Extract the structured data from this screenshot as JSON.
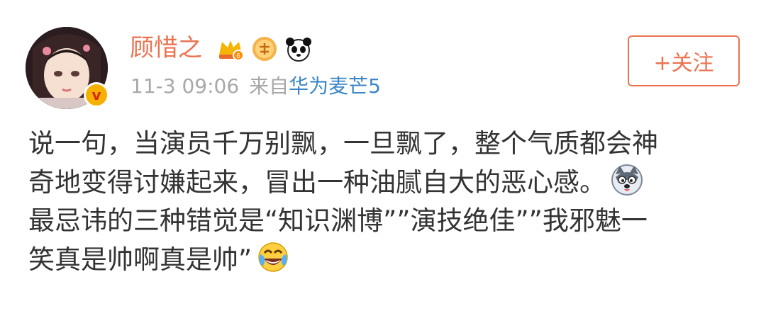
{
  "post": {
    "author": {
      "name": "顾惜之",
      "verified_mark": "v",
      "badges": [
        "crown-level-6-badge",
        "answer-badge",
        "panda-badge"
      ]
    },
    "timestamp": "11-3 09:06",
    "source_label": "来自",
    "source_device": "华为麦芒5",
    "follow_label": "+关注",
    "text_lines": [
      "说一句，当演员千万别飘，一旦飘了，整个气质都会神",
      "奇地变得讨嫌起来，冒出一种油腻自大的恶心感。",
      "最忌讳的三种错觉是“知识渊博””演技绝佳””我邪魅一",
      "笑真是帅啊真是帅”"
    ],
    "emojis": [
      "husky-emoji",
      "laughing-tears-emoji"
    ]
  },
  "colors": {
    "username": "#eb7350",
    "link": "#3b86c6",
    "meta": "#a8a8a8",
    "text": "#333333"
  }
}
